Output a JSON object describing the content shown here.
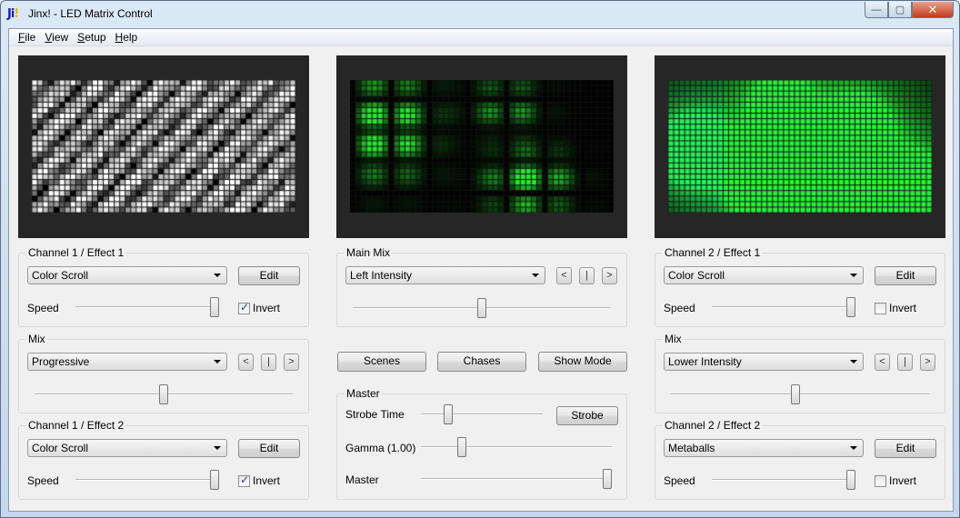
{
  "window": {
    "icon_text": "Ji",
    "icon_bang": "!",
    "title": "Jinx! - LED Matrix Control",
    "controls": {
      "minimize": "—",
      "maximize": "▢",
      "close": "✕"
    }
  },
  "menu": [
    {
      "label": "File",
      "accel": "F",
      "rest": "ile"
    },
    {
      "label": "View",
      "accel": "V",
      "rest": "iew"
    },
    {
      "label": "Setup",
      "accel": "S",
      "rest": "etup"
    },
    {
      "label": "Help",
      "accel": "H",
      "rest": "elp"
    }
  ],
  "previews": {
    "grid": {
      "cols": 48,
      "rows": 24
    },
    "channel1": {
      "effect": "Color Scroll",
      "palette": "grayscale"
    },
    "main": {
      "effect": "Main Mix Output",
      "palette": "green-sparse"
    },
    "channel2": {
      "effect": "Metaballs",
      "palette": "green-blobs"
    }
  },
  "channel1": {
    "effect1": {
      "title": "Channel 1 / Effect 1",
      "effect": "Color Scroll",
      "edit_label": "Edit",
      "speed_label": "Speed",
      "speed": 1.0,
      "invert_label": "Invert",
      "invert": true
    },
    "mix": {
      "title": "Mix",
      "mode": "Progressive",
      "prev": "<",
      "stop": "|",
      "next": ">",
      "value": 0.5
    },
    "effect2": {
      "title": "Channel 1 / Effect 2",
      "effect": "Color Scroll",
      "edit_label": "Edit",
      "speed_label": "Speed",
      "speed": 1.0,
      "invert_label": "Invert",
      "invert": true
    }
  },
  "main_mix": {
    "title": "Main Mix",
    "mode": "Left Intensity",
    "prev": "<",
    "stop": "|",
    "next": ">",
    "value": 0.5
  },
  "actions": {
    "scenes": "Scenes",
    "chases": "Chases",
    "show_mode": "Show Mode"
  },
  "master": {
    "title": "Master",
    "strobe_time_label": "Strobe Time",
    "strobe_time": 0.2,
    "strobe_button": "Strobe",
    "gamma_label": "Gamma (1.00)",
    "gamma": 0.2,
    "master_label": "Master",
    "master": 1.0
  },
  "channel2": {
    "effect1": {
      "title": "Channel 2 / Effect 1",
      "effect": "Color Scroll",
      "edit_label": "Edit",
      "speed_label": "Speed",
      "speed": 1.0,
      "invert_label": "Invert",
      "invert": false
    },
    "mix": {
      "title": "Mix",
      "mode": "Lower Intensity",
      "prev": "<",
      "stop": "|",
      "next": ">",
      "value": 0.48
    },
    "effect2": {
      "title": "Channel 2 / Effect 2",
      "effect": "Metaballs",
      "edit_label": "Edit",
      "speed_label": "Speed",
      "speed": 1.0,
      "invert_label": "Invert",
      "invert": false
    }
  }
}
